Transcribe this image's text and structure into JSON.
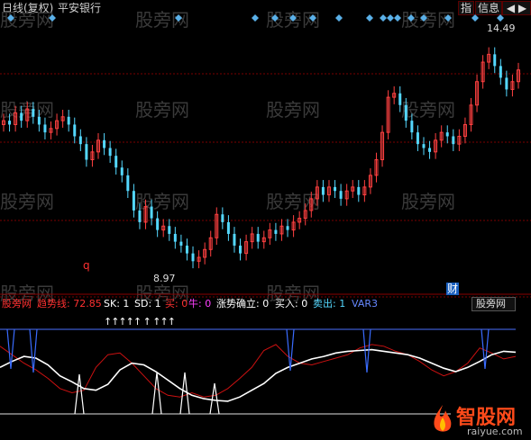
{
  "header": {
    "period_label": "日线(复权)",
    "stock_name": "平安银行",
    "btn_index": "指",
    "btn_info": "信息",
    "btn_nav": "◀ ▶"
  },
  "watermarks": [
    "股旁网",
    "股旁网",
    "股旁网",
    "股旁网",
    "股旁网",
    "股旁网",
    "股旁网",
    "股旁网",
    "股旁网",
    "股旁网",
    "股旁网",
    "股旁网",
    "股旁网",
    "股旁网",
    "股旁网"
  ],
  "price_labels": {
    "high": "14.49",
    "low": "8.97",
    "q_marker": "q",
    "cai_marker": "财"
  },
  "indicator": {
    "name": "股旁网",
    "trend_label": "趋势线: 72.85",
    "sk": "SK: 1",
    "sd": "SD: 1",
    "buy": "买: 0",
    "bull": "牛: 0",
    "trend_confirm": "涨势确立: 0",
    "buy_in": "买入: 0",
    "sell_out": "卖出: 1",
    "var": "VAR3",
    "dropdown": "股旁网",
    "arrows": "↑↑↑↑↑ ↑ ↑↑↑"
  },
  "logo": {
    "main": "智股网",
    "sub": "raiyue.com"
  },
  "colors": {
    "up": "#ff4040",
    "down": "#54d8ff",
    "diamond": "#5ab0e8",
    "trend": "#ffffff",
    "sk": "#ffff66",
    "red_line": "#cc1111",
    "blue_line": "#5a80ff"
  },
  "chart_data": [
    {
      "type": "candlestick",
      "title": "",
      "high_label": 14.49,
      "low_label": 8.97,
      "ylim": [
        8.5,
        15.0
      ],
      "close": [
        12.6,
        12.5,
        12.8,
        12.6,
        12.9,
        12.7,
        12.5,
        12.3,
        12.4,
        12.6,
        12.7,
        12.5,
        12.2,
        12.0,
        11.6,
        11.8,
        12.1,
        11.9,
        11.7,
        11.4,
        11.2,
        10.8,
        10.3,
        10.0,
        10.4,
        10.1,
        9.8,
        9.9,
        9.7,
        9.5,
        9.4,
        9.2,
        9.0,
        9.1,
        9.3,
        9.6,
        10.2,
        10.0,
        9.7,
        9.4,
        9.2,
        9.5,
        9.7,
        9.5,
        9.6,
        9.8,
        9.7,
        9.9,
        9.8,
        10.0,
        10.1,
        10.3,
        10.6,
        10.9,
        10.7,
        10.9,
        10.8,
        10.6,
        10.8,
        10.9,
        10.7,
        10.9,
        11.2,
        11.6,
        12.3,
        13.2,
        13.3,
        13.0,
        12.6,
        12.3,
        12.0,
        11.9,
        11.8,
        12.1,
        12.3,
        12.2,
        12.0,
        12.2,
        12.5,
        13.0,
        13.6,
        14.1,
        14.3,
        14.0,
        13.7,
        13.4,
        13.6,
        13.9
      ]
    },
    {
      "type": "line",
      "title": "",
      "series": [
        {
          "name": "趋势线",
          "values": [
            55,
            62,
            68,
            66,
            58,
            45,
            38,
            30,
            28,
            35,
            52,
            60,
            58,
            50,
            40,
            30,
            22,
            18,
            16,
            15,
            20,
            28,
            36,
            48,
            55,
            60,
            65,
            68,
            72,
            74,
            75,
            76,
            74,
            72,
            70,
            66,
            60,
            54,
            50,
            55,
            62,
            70,
            74,
            73
          ]
        },
        {
          "name": "VAR3",
          "values": [
            80,
            70,
            60,
            52,
            42,
            30,
            25,
            28,
            55,
            70,
            72,
            60,
            45,
            30,
            22,
            20,
            25,
            20,
            22,
            30,
            42,
            55,
            75,
            82,
            68,
            60,
            58,
            62,
            66,
            70,
            78,
            82,
            80,
            74,
            70,
            62,
            52,
            45,
            50,
            60,
            78,
            72,
            65,
            68
          ]
        }
      ],
      "ylim": [
        0,
        100
      ]
    }
  ]
}
